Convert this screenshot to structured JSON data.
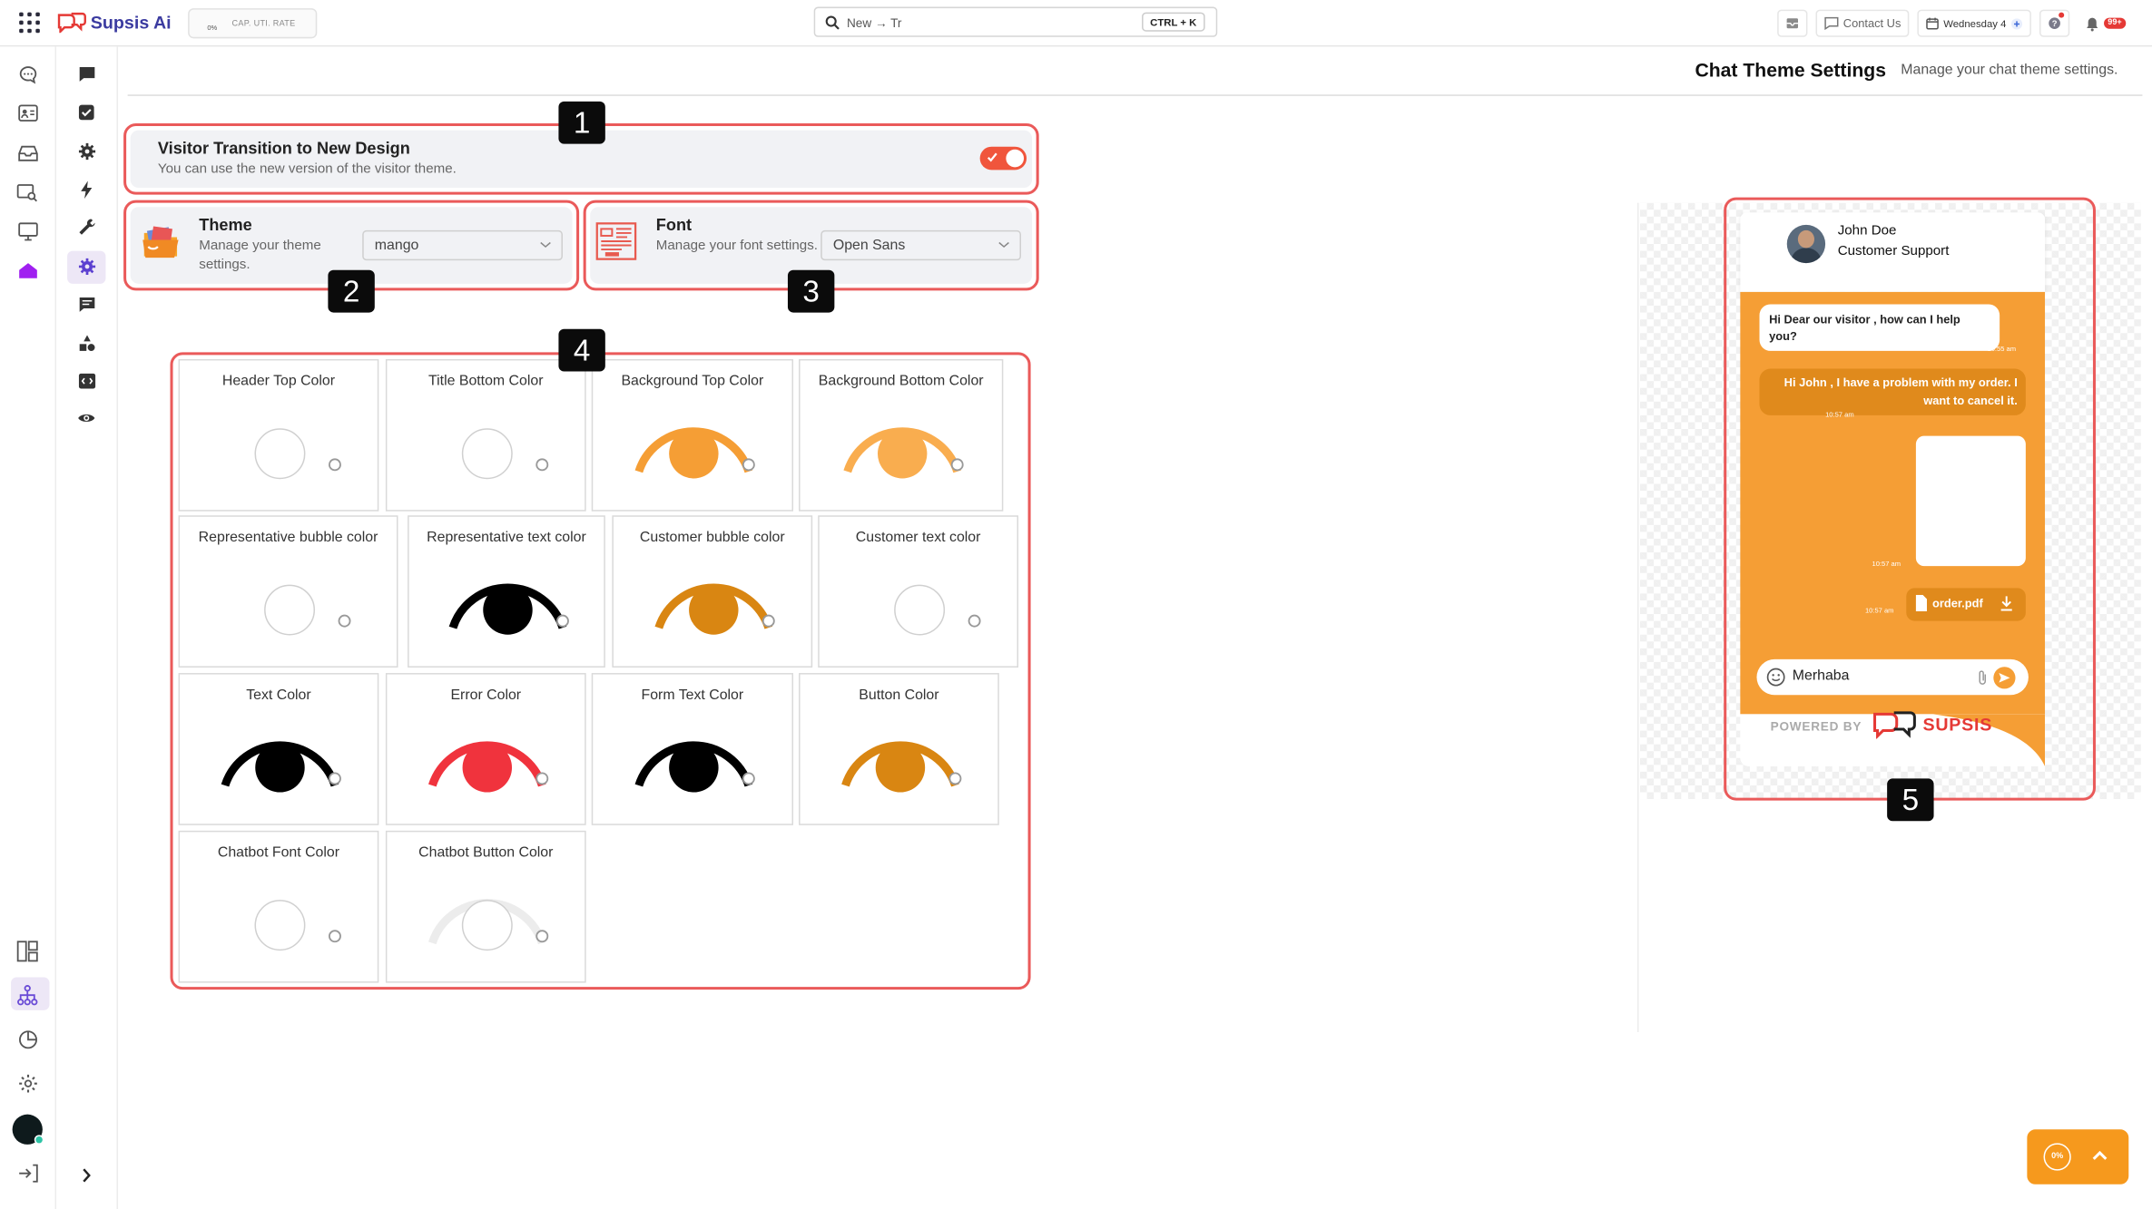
{
  "topbar": {
    "brand": "Supsis Ai",
    "cap_percent": "0%",
    "cap_label": "CAP. UTI. RATE",
    "search_value": "New → Tr",
    "search_shortcut": "CTRL + K",
    "contact_label": "Contact Us",
    "calendar_label": "Wednesday 4",
    "notification_badge": "99+"
  },
  "header": {
    "title": "Chat Theme Settings",
    "subtitle": "Manage your chat theme settings."
  },
  "visitor_transition": {
    "title": "Visitor Transition to New Design",
    "description": "You can use the new version of the visitor theme.",
    "enabled": true
  },
  "theme": {
    "title": "Theme",
    "description": "Manage your theme settings.",
    "selected": "mango"
  },
  "font": {
    "title": "Font",
    "description": "Manage your font settings.",
    "selected": "Open Sans"
  },
  "callouts": [
    "1",
    "2",
    "3",
    "4",
    "5"
  ],
  "colors": [
    {
      "label": "Header Top Color",
      "color": "#ffffff"
    },
    {
      "label": "Title Bottom Color",
      "color": "#ffffff"
    },
    {
      "label": "Background Top Color",
      "color": "#f59e35"
    },
    {
      "label": "Background Bottom Color",
      "color": "#f9ad4f"
    },
    {
      "label": "Representative bubble color",
      "color": "#ffffff"
    },
    {
      "label": "Representative text color",
      "color": "#000000"
    },
    {
      "label": "Customer bubble color",
      "color": "#d98612"
    },
    {
      "label": "Customer text color",
      "color": "#ffffff"
    },
    {
      "label": "Text Color",
      "color": "#000000"
    },
    {
      "label": "Error Color",
      "color": "#f0333d"
    },
    {
      "label": "Form Text Color",
      "color": "#000000"
    },
    {
      "label": "Button Color",
      "color": "#d98612"
    },
    {
      "label": "Chatbot Font Color",
      "color": "#ffffff"
    },
    {
      "label": "Chatbot Button Color",
      "color": "#ffffff"
    }
  ],
  "preview": {
    "agent_name": "John Doe",
    "agent_role": "Customer Support",
    "msg_rep": "Hi Dear our visitor , how can I help you?",
    "msg_rep_time": "10:55 am",
    "msg_customer": "Hi John , I have a problem with my order. I want to cancel it.",
    "msg_customer_time": "10:57 am",
    "image_time": "10:57 am",
    "file_name": "order.pdf",
    "file_time": "10:57 am",
    "input_value": "Merhaba",
    "powered_by": "POWERED BY",
    "brand_mark": "SUPSIS"
  },
  "fab": {
    "percent": "0%"
  }
}
